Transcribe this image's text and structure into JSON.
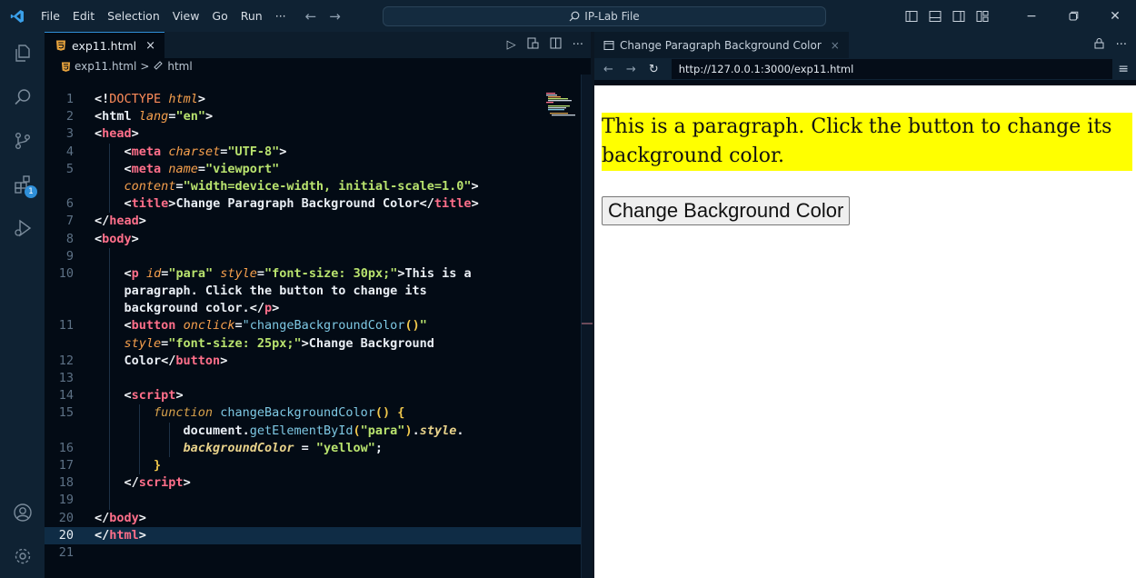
{
  "titlebar": {
    "menu": [
      "File",
      "Edit",
      "Selection",
      "View",
      "Go",
      "Run",
      "···"
    ],
    "search_text": "IP-Lab File"
  },
  "activity": {
    "extensions_badge": "1"
  },
  "editor": {
    "tab_label": "exp11.html",
    "tab_close": "×",
    "breadcrumb_file": "exp11.html",
    "breadcrumb_sep": ">",
    "breadcrumb_symbol": "html",
    "line_numbers": [
      "1",
      "2",
      "3",
      "4",
      "5",
      "",
      "6",
      "7",
      "8",
      "9",
      "10",
      "",
      "",
      "11",
      "",
      "12",
      "13",
      "14",
      "15",
      "",
      "16",
      "17",
      "18",
      "19",
      "20",
      "21"
    ],
    "current_line": "20"
  },
  "preview": {
    "tab_title": "Change Paragraph Background Color",
    "tab_close": "×",
    "url": "http://127.0.0.1:3000/exp11.html",
    "paragraph": "This is a paragraph. Click the button to change its background color.",
    "button_label": "Change Background Color",
    "paragraph_bg": "#ffff00"
  },
  "colors": {
    "accent": "#2f8fd8",
    "editor_bg": "#030b15",
    "chrome_bg": "#0f2233"
  }
}
